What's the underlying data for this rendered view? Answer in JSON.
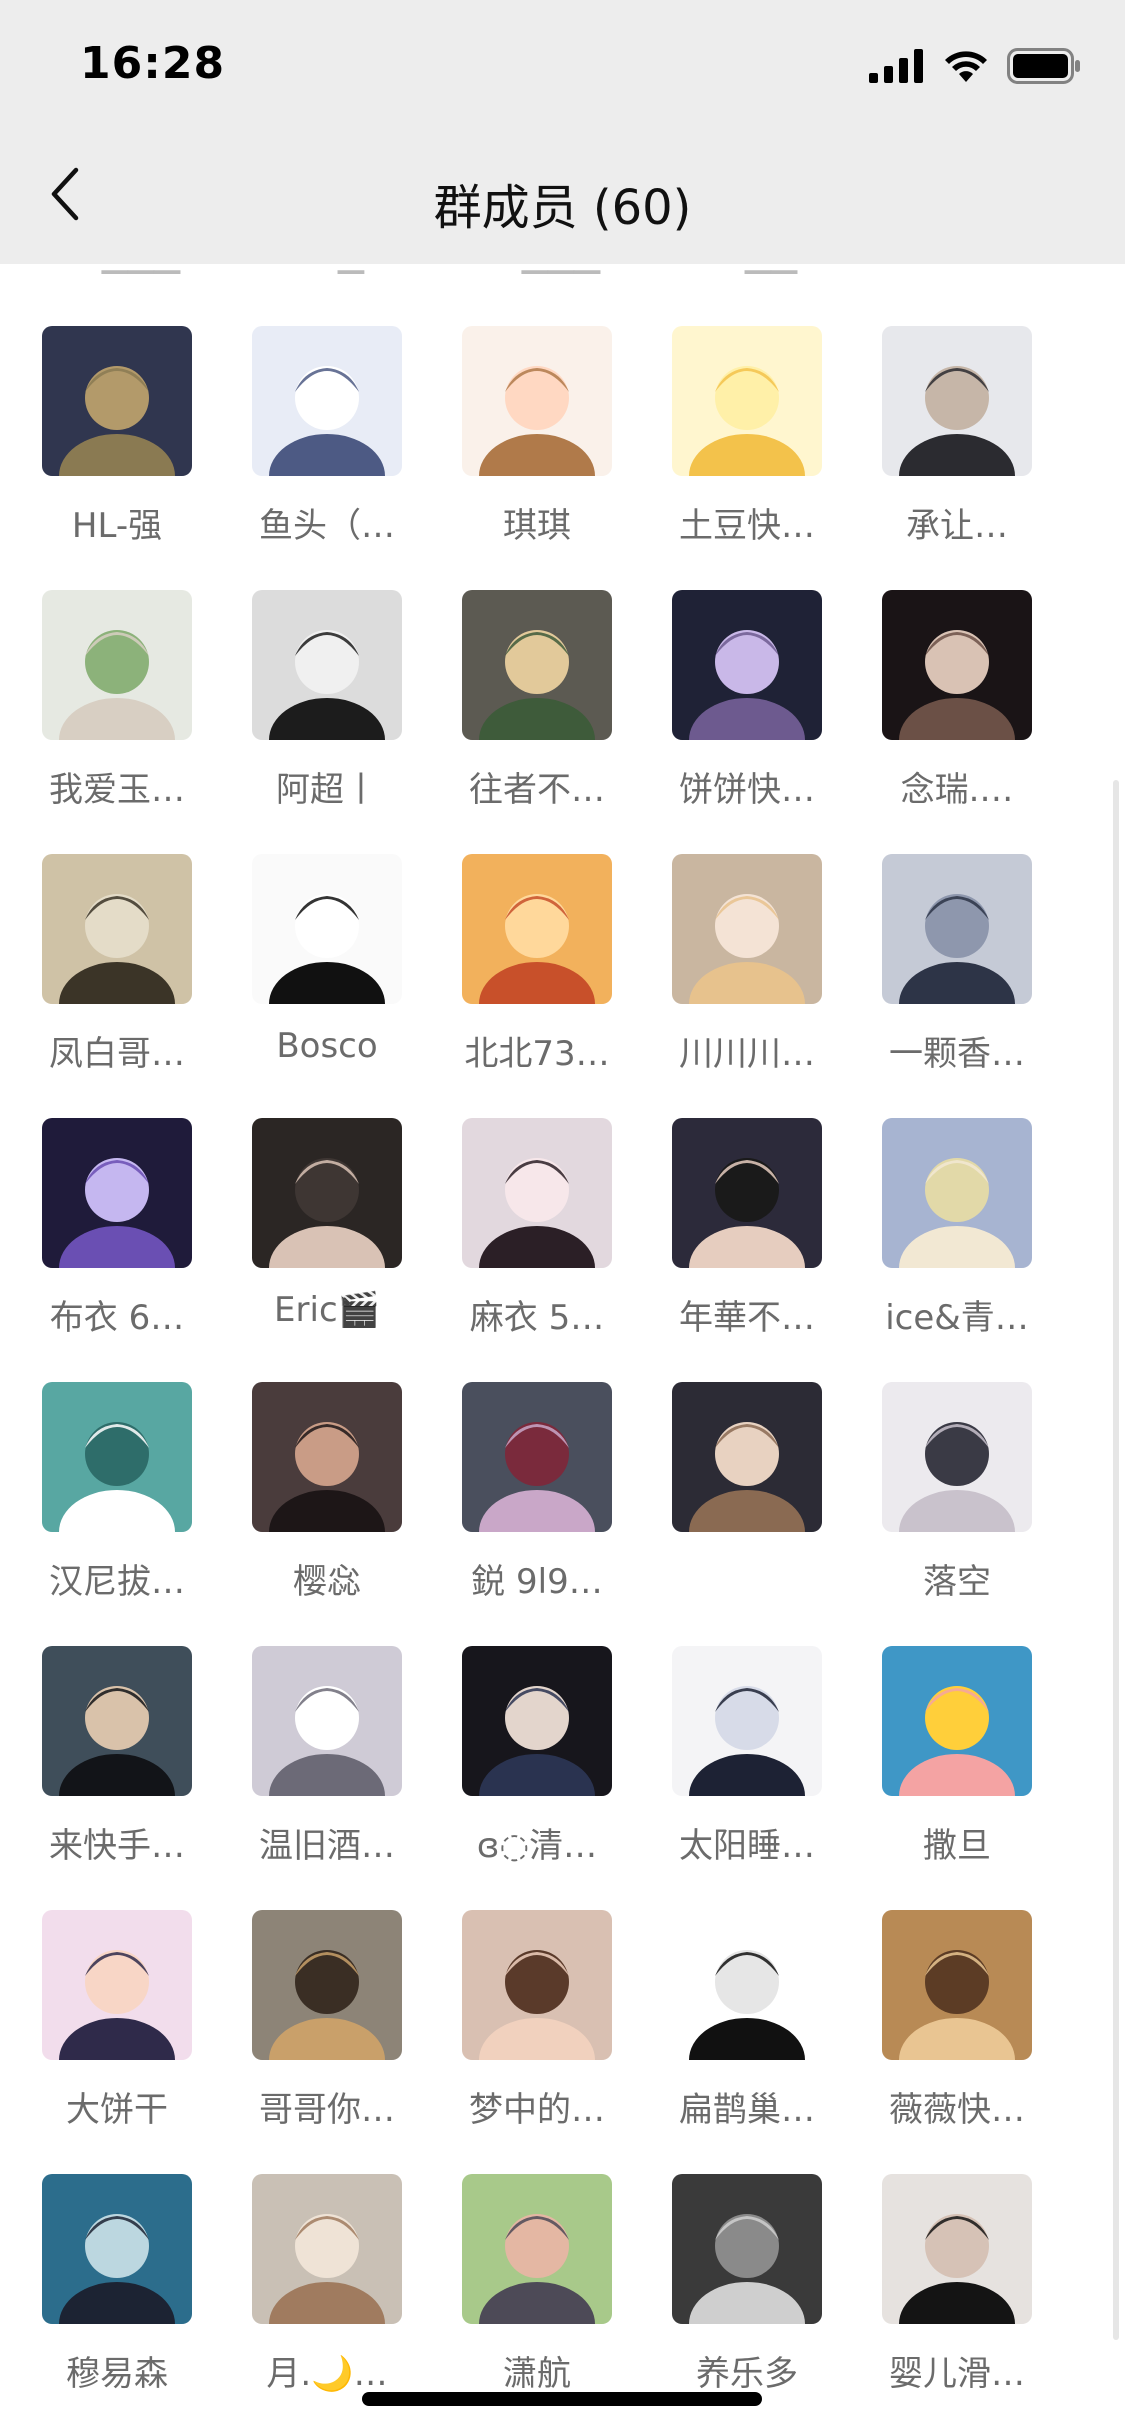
{
  "status_bar": {
    "time": "16:28",
    "icons": [
      "signal-icon",
      "wifi-icon",
      "battery-icon"
    ]
  },
  "nav": {
    "back_icon": "chevron-left-icon",
    "title": "群成员 (60)"
  },
  "members": [
    {
      "name": "HL-强",
      "avatar": [
        "#30364f",
        "#8a7a52",
        "#b39a6a"
      ]
    },
    {
      "name": "鱼头（…",
      "avatar": [
        "#e8ecf6",
        "#4d5a84",
        "#ffffff"
      ]
    },
    {
      "name": "琪琪",
      "avatar": [
        "#faf1ea",
        "#b07a4a",
        "#ffd8c2"
      ]
    },
    {
      "name": "土豆快…",
      "avatar": [
        "#fff6cf",
        "#f3c24b",
        "#fff0a8"
      ]
    },
    {
      "name": "承让…",
      "avatar": [
        "#e7e8ec",
        "#2b2b30",
        "#c6b6a8"
      ]
    },
    {
      "name": "我爱玉…",
      "avatar": [
        "#e6e9e2",
        "#d8cfc3",
        "#8cb27a"
      ]
    },
    {
      "name": "阿超丨",
      "avatar": [
        "#dcdcdc",
        "#1c1c1c",
        "#f0f0f0"
      ]
    },
    {
      "name": "往者不…",
      "avatar": [
        "#5c5a52",
        "#3e5b3a",
        "#e2c99a"
      ]
    },
    {
      "name": "饼饼快…",
      "avatar": [
        "#1f2236",
        "#6d5a8f",
        "#c9b8e8"
      ]
    },
    {
      "name": "念瑞.…",
      "avatar": [
        "#1a1416",
        "#6b5046",
        "#d9c2b4"
      ]
    },
    {
      "name": "凤白哥…",
      "avatar": [
        "#cfc2a6",
        "#3b3427",
        "#e4dcc8"
      ]
    },
    {
      "name": "Bosco",
      "avatar": [
        "#fafafa",
        "#111111",
        "#ffffff"
      ]
    },
    {
      "name": "北北73…",
      "avatar": [
        "#f2b15c",
        "#c8502a",
        "#ffd89b"
      ]
    },
    {
      "name": "川川川…",
      "avatar": [
        "#c9b6a0",
        "#e7c28d",
        "#f4e3d5"
      ]
    },
    {
      "name": "一颗香…",
      "avatar": [
        "#c5cad6",
        "#2d3447",
        "#8e97ad"
      ]
    },
    {
      "name": "布衣 6…",
      "avatar": [
        "#1f1b3a",
        "#6a4fb3",
        "#c5b7f0"
      ]
    },
    {
      "name": "Eric🎬",
      "avatar": [
        "#2b2624",
        "#d9c2b5",
        "#3e3633"
      ]
    },
    {
      "name": "麻衣 5…",
      "avatar": [
        "#e2d8de",
        "#2b1f26",
        "#f7e7ea"
      ]
    },
    {
      "name": "年華不…",
      "avatar": [
        "#2c2a3a",
        "#e6cdbf",
        "#1a1a1a"
      ]
    },
    {
      "name": "ice&青…",
      "avatar": [
        "#a7b4d1",
        "#f2e8d3",
        "#e2d9a8"
      ]
    },
    {
      "name": "汉尼拔…",
      "avatar": [
        "#58a7a2",
        "#ffffff",
        "#2e6d6a"
      ]
    },
    {
      "name": "樱惢",
      "avatar": [
        "#4a3c3c",
        "#1d1617",
        "#c99c86"
      ]
    },
    {
      "name": "鋭 9l9…",
      "avatar": [
        "#4a4f5d",
        "#c9a7c8",
        "#7a2a3c"
      ]
    },
    {
      "name": "",
      "avatar": [
        "#2c2b35",
        "#8a6a52",
        "#e8d2c1"
      ]
    },
    {
      "name": "落空",
      "avatar": [
        "#eceaee",
        "#c9c2cc",
        "#3a3a45"
      ]
    },
    {
      "name": "来快手…",
      "avatar": [
        "#3f4e5a",
        "#121418",
        "#d9c2aa"
      ]
    },
    {
      "name": "温旧酒…",
      "avatar": [
        "#cfcbd6",
        "#6c6a77",
        "#ffffff"
      ]
    },
    {
      "name": "ɞ◌清…",
      "avatar": [
        "#17161c",
        "#2a3350",
        "#e3d5cc"
      ]
    },
    {
      "name": "太阳睡…",
      "avatar": [
        "#f4f4f6",
        "#1d2234",
        "#d7dbe8"
      ]
    },
    {
      "name": "撒旦",
      "avatar": [
        "#3f97c6",
        "#f4a3a3",
        "#ffcf3a"
      ]
    },
    {
      "name": "大饼干",
      "avatar": [
        "#f2ddec",
        "#2f2a4a",
        "#f8d6c6"
      ]
    },
    {
      "name": "哥哥你…",
      "avatar": [
        "#8d8477",
        "#c9a06a",
        "#3a2e24"
      ]
    },
    {
      "name": "梦中的…",
      "avatar": [
        "#d9c0b2",
        "#f1d1be",
        "#5a3a2a"
      ]
    },
    {
      "name": "扁鹊巢…",
      "avatar": [
        "#ffffff",
        "#111111",
        "#e6e6e6"
      ]
    },
    {
      "name": "薇薇快…",
      "avatar": [
        "#b88a55",
        "#e9c592",
        "#5c3c25"
      ]
    },
    {
      "name": "穆易森",
      "avatar": [
        "#2c6d8c",
        "#1c2333",
        "#bcd7e0"
      ]
    },
    {
      "name": "月.🌙…",
      "avatar": [
        "#c9c0b5",
        "#a07b5f",
        "#efe3d6"
      ]
    },
    {
      "name": "潇航",
      "avatar": [
        "#a8c98a",
        "#4d4a57",
        "#e4b7a3"
      ]
    },
    {
      "name": "养乐多",
      "avatar": [
        "#3a3a3a",
        "#cfcfcf",
        "#8a8a8a"
      ]
    },
    {
      "name": "婴儿滑…",
      "avatar": [
        "#e6e2df",
        "#141414",
        "#d6c2b6"
      ]
    }
  ]
}
